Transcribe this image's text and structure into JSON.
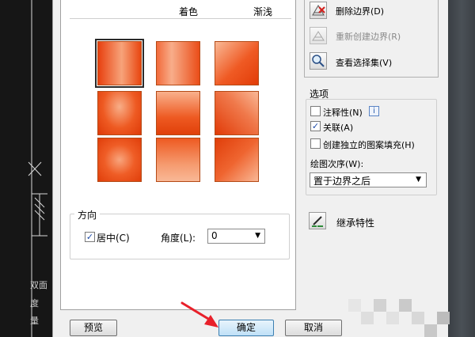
{
  "gradient_panel": {
    "header_col1": "着色",
    "header_col2": "渐浅",
    "swatch_color": "#f2531b"
  },
  "direction": {
    "group_title": "方向",
    "center_label": "居中(C)",
    "center_checked": "✓",
    "angle_label": "角度(L):",
    "angle_value": "0"
  },
  "boundary_buttons": {
    "delete_label": "删除边界(D)",
    "recreate_label": "重新创建边界(R)",
    "view_selection_label": "查看选择集(V)"
  },
  "options": {
    "title": "选项",
    "annotative_label": "注释性(N)",
    "info_glyph": "i",
    "associative_label": "关联(A)",
    "associative_checked": "✓",
    "separate_hatch_label": "创建独立的图案填充(H)",
    "draw_order_label": "绘图次序(W):",
    "draw_order_value": "置于边界之后"
  },
  "inherit": {
    "label": "继承特性"
  },
  "buttons": {
    "preview": "预览",
    "ok": "确定",
    "cancel": "取消"
  },
  "cad_fragments": {
    "line1": "双面",
    "line2": "度",
    "line3": "量"
  },
  "colors": {
    "accent_orange": "#f2531b",
    "annotation_red": "#e8202a",
    "ok_blue": "#3c7fb1"
  }
}
